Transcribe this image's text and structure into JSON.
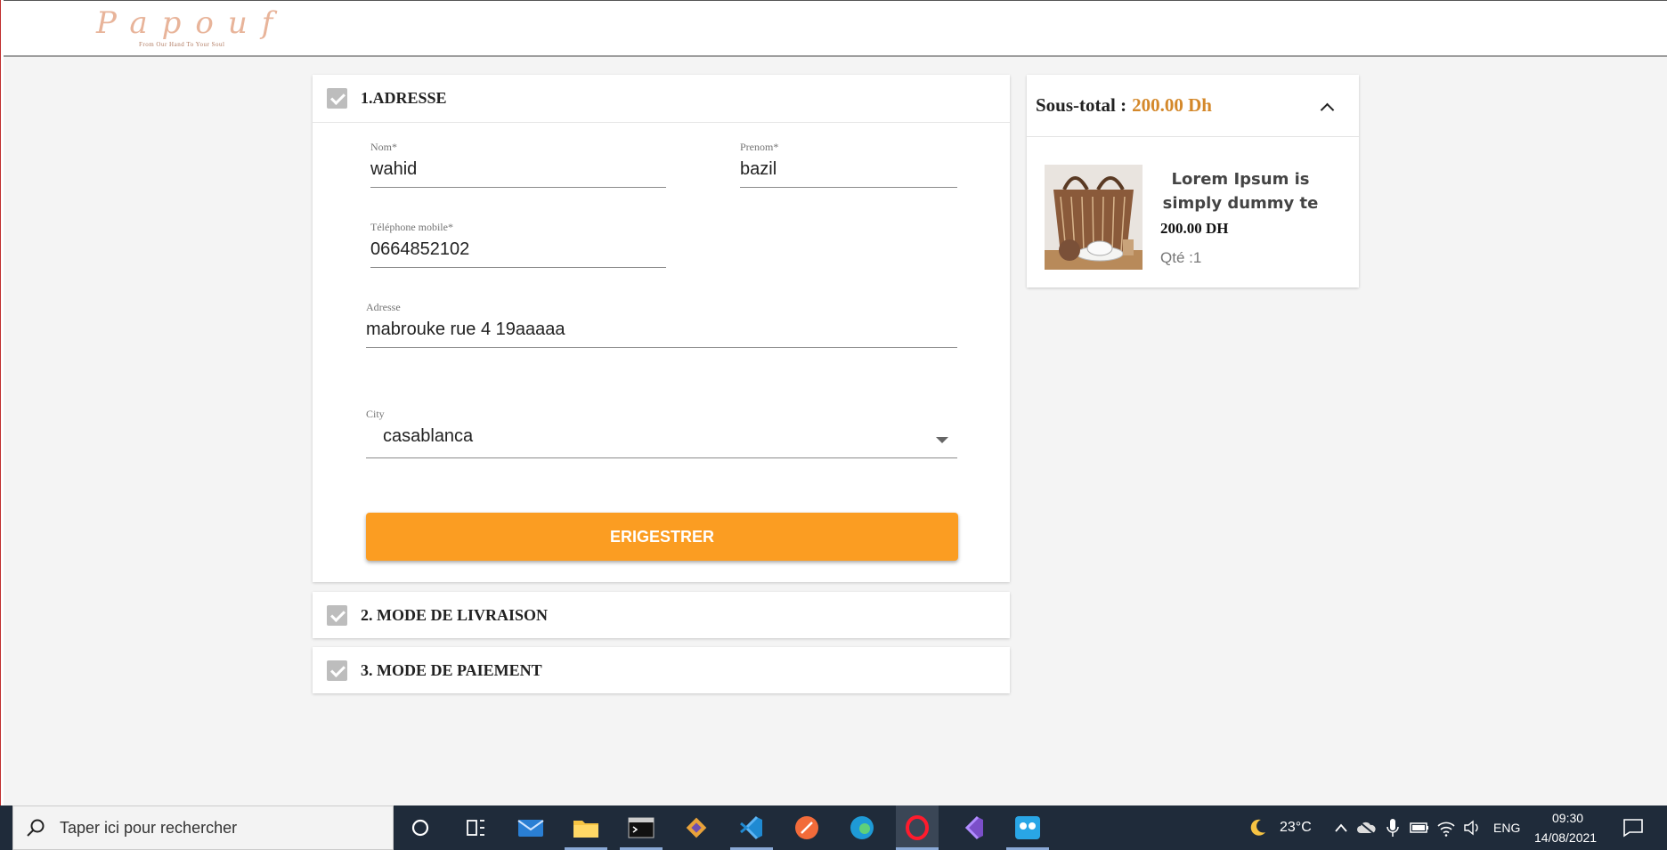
{
  "header": {
    "logo_text": "Papouf",
    "logo_tagline": "From Our Hand To Your Soul"
  },
  "address_section": {
    "title": "1.ADRESSE",
    "fields": {
      "nom": {
        "label": "Nom*",
        "value": "wahid"
      },
      "prenom": {
        "label": "Prenom*",
        "value": "bazil"
      },
      "telephone": {
        "label": "Téléphone mobile*",
        "value": "0664852102"
      },
      "adresse": {
        "label": "Adresse",
        "value": "mabrouke rue 4 19aaaaa"
      },
      "city": {
        "label": "City",
        "value": "casablanca"
      }
    },
    "save_label": "ERIGESTRER"
  },
  "delivery_section": {
    "title": "2. MODE DE LIVRAISON"
  },
  "payment_section": {
    "title": "3. MODE DE PAIEMENT"
  },
  "summary": {
    "subtotal_label": "Sous-total :",
    "subtotal_value": "200.00 Dh",
    "item": {
      "name": "Lorem Ipsum is simply dummy te",
      "price": "200.00 DH",
      "qty": "Qté :1"
    }
  },
  "taskbar": {
    "search_placeholder": "Taper ici pour rechercher",
    "weather": "23°C",
    "language": "ENG",
    "time": "09:30",
    "date": "14/08/2021"
  },
  "colors": {
    "accent": "#fb9d22",
    "price": "#d4882a",
    "taskbar": "#1f2b3a"
  }
}
